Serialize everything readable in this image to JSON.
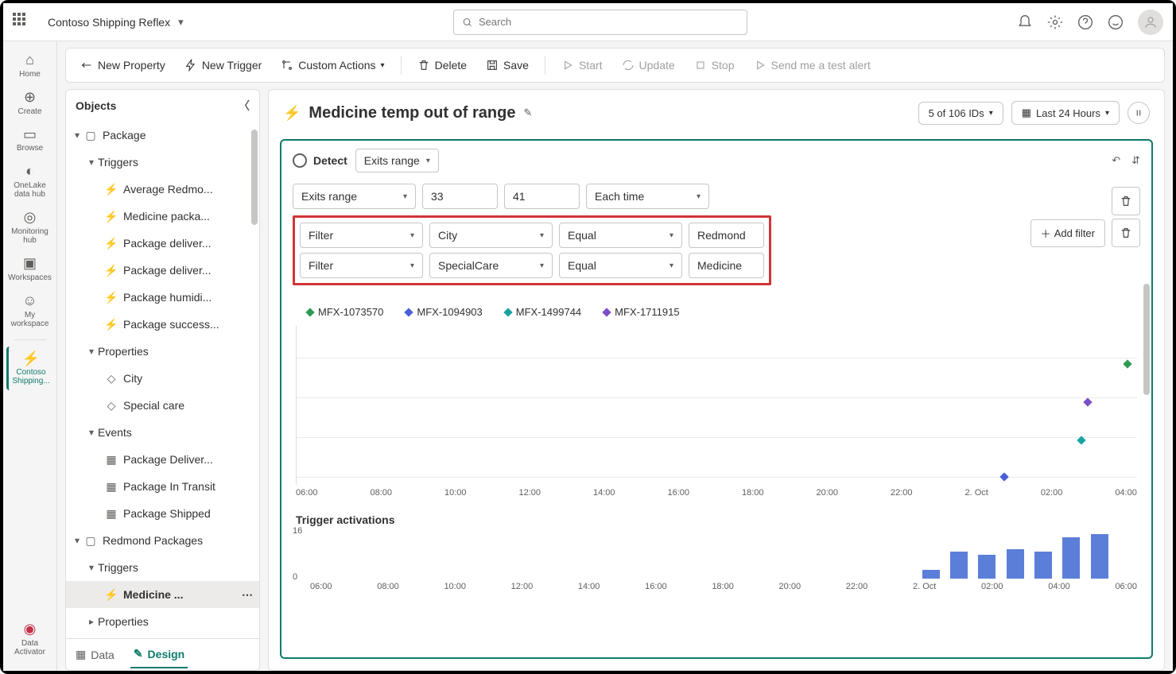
{
  "app_title": "Contoso Shipping Reflex",
  "search_placeholder": "Search",
  "rail": [
    {
      "label": "Home"
    },
    {
      "label": "Create"
    },
    {
      "label": "Browse"
    },
    {
      "label": "OneLake data hub"
    },
    {
      "label": "Monitoring hub"
    },
    {
      "label": "Workspaces"
    },
    {
      "label": "My workspace"
    },
    {
      "label": "Contoso Shipping..."
    }
  ],
  "rail_bottom": "Data Activator",
  "cmd": {
    "new_property": "New Property",
    "new_trigger": "New Trigger",
    "custom_actions": "Custom Actions",
    "delete": "Delete",
    "save": "Save",
    "start": "Start",
    "update": "Update",
    "stop": "Stop",
    "send_test": "Send me a test alert"
  },
  "objects_header": "Objects",
  "tree": {
    "package": "Package",
    "triggers": "Triggers",
    "trigger_items": [
      "Average Redmo...",
      "Medicine packa...",
      "Package deliver...",
      "Package deliver...",
      "Package humidi...",
      "Package success..."
    ],
    "properties": "Properties",
    "property_items": [
      "City",
      "Special care"
    ],
    "events": "Events",
    "event_items": [
      "Package Deliver...",
      "Package In Transit",
      "Package Shipped"
    ],
    "redmond": "Redmond Packages",
    "redmond_triggers": "Triggers",
    "redmond_trigger_sel": "Medicine ...",
    "redmond_properties": "Properties"
  },
  "bottom_tabs": {
    "data": "Data",
    "design": "Design"
  },
  "page_title": "Medicine temp out of range",
  "ids_summary": "5 of 106 IDs",
  "time_range": "Last 24 Hours",
  "detect_label": "Detect",
  "detect_mode": "Exits range",
  "row_condition": {
    "mode": "Exits range",
    "low": "33",
    "high": "41",
    "freq": "Each time"
  },
  "filters": [
    {
      "type": "Filter",
      "field": "City",
      "op": "Equal",
      "value": "Redmond"
    },
    {
      "type": "Filter",
      "field": "SpecialCare",
      "op": "Equal",
      "value": "Medicine"
    }
  ],
  "add_filter": "Add filter",
  "legend": [
    {
      "name": "MFX-1073570",
      "color": "#2e9b55"
    },
    {
      "name": "MFX-1094903",
      "color": "#4a5fd8"
    },
    {
      "name": "MFX-1499744",
      "color": "#1aa3a3"
    },
    {
      "name": "MFX-1711915",
      "color": "#7a4fc7"
    }
  ],
  "xaxis": [
    "06:00",
    "08:00",
    "10:00",
    "12:00",
    "14:00",
    "16:00",
    "18:00",
    "20:00",
    "22:00",
    "2. Oct",
    "02:00",
    "04:00"
  ],
  "chart2_title": "Trigger activations",
  "chart_data": {
    "type": "bar",
    "title": "Trigger activations",
    "categories": [
      "06:00",
      "08:00",
      "10:00",
      "12:00",
      "14:00",
      "16:00",
      "18:00",
      "20:00",
      "22:00",
      "2. Oct",
      "02:00",
      "04:00",
      "06:00"
    ],
    "values": [
      0,
      0,
      0,
      0,
      0,
      0,
      0,
      0,
      0,
      0,
      3,
      9,
      8,
      10,
      9,
      14,
      15
    ],
    "ylim": [
      0,
      16
    ],
    "yticks": [
      0,
      16
    ]
  },
  "scatter_points": [
    {
      "series": 0,
      "x_pct": 98.5,
      "y_pct": 22
    },
    {
      "series": 3,
      "x_pct": 93.8,
      "y_pct": 46
    },
    {
      "series": 2,
      "x_pct": 93.0,
      "y_pct": 70
    },
    {
      "series": 1,
      "x_pct": 83.8,
      "y_pct": 93
    }
  ]
}
